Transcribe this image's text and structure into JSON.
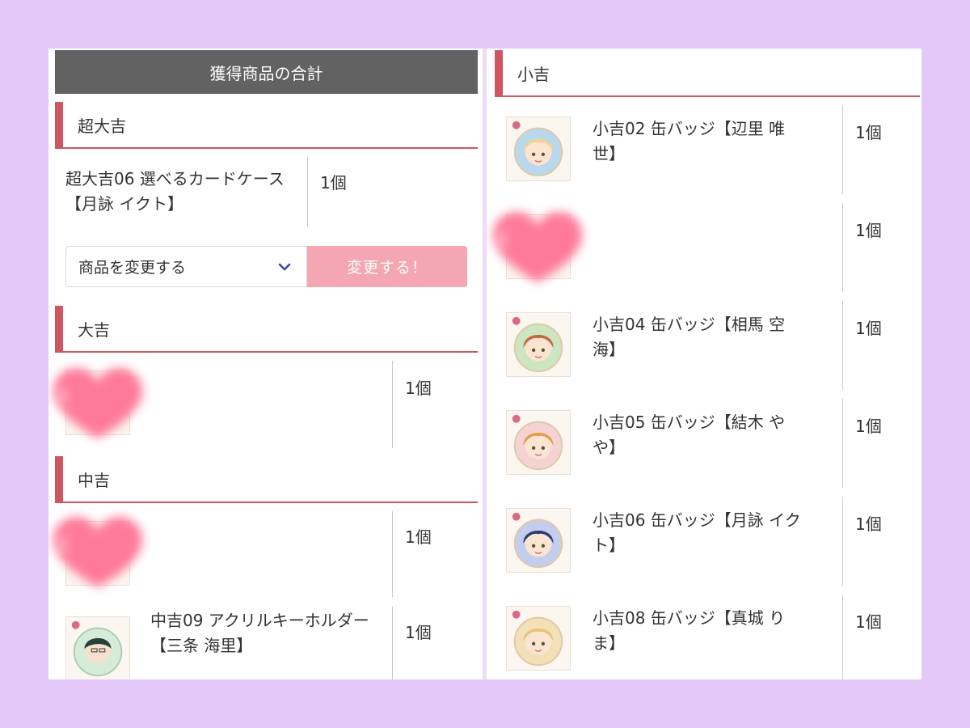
{
  "left_panel": {
    "header_title": "獲得商品の合計",
    "sections": {
      "super_great": {
        "title": "超大吉",
        "item_name_line1": "超大吉06 選べるカードケース",
        "item_name_line2": "【月詠 イクト】",
        "qty": "1個",
        "select_placeholder": "商品を変更する",
        "change_button": "変更する！"
      },
      "great": {
        "title": "大吉",
        "qty": "1個"
      },
      "middle": {
        "title": "中吉",
        "item1_qty": "1個",
        "item2_name_line1": "中吉09 アクリルキーホルダー",
        "item2_name_line2": "【三条 海里】",
        "item2_qty": "1個"
      }
    }
  },
  "right_panel": {
    "section_title": "小吉",
    "items": [
      {
        "line1": "小吉02 缶バッジ【辺里 唯",
        "line2": "世】",
        "qty": "1個",
        "hair": "#f0d48e",
        "bg": "#b8d8ee"
      },
      {
        "line1": "",
        "line2": "",
        "qty": "1個",
        "hair": "",
        "bg": ""
      },
      {
        "line1": "小吉04 缶バッジ【相馬 空",
        "line2": "海】",
        "qty": "1個",
        "hair": "#c0683e",
        "bg": "#cbe6c0"
      },
      {
        "line1": "小吉05 缶バッジ【結木 や",
        "line2": "や】",
        "qty": "1個",
        "hair": "#e59a52",
        "bg": "#f6d3d3"
      },
      {
        "line1": "小吉06 缶バッジ【月詠 イク",
        "line2": "ト】",
        "qty": "1個",
        "hair": "#2c3b74",
        "bg": "#c3cdee"
      },
      {
        "line1": "小吉08 缶バッジ【真城 り",
        "line2": "ま】",
        "qty": "1個",
        "hair": "#e9c477",
        "bg": "#f3e0b6"
      }
    ]
  },
  "colors": {
    "accent": "#cf5561",
    "header_bar": "#626262",
    "button": "#f4a6b2",
    "background": "#e3c8f8"
  }
}
